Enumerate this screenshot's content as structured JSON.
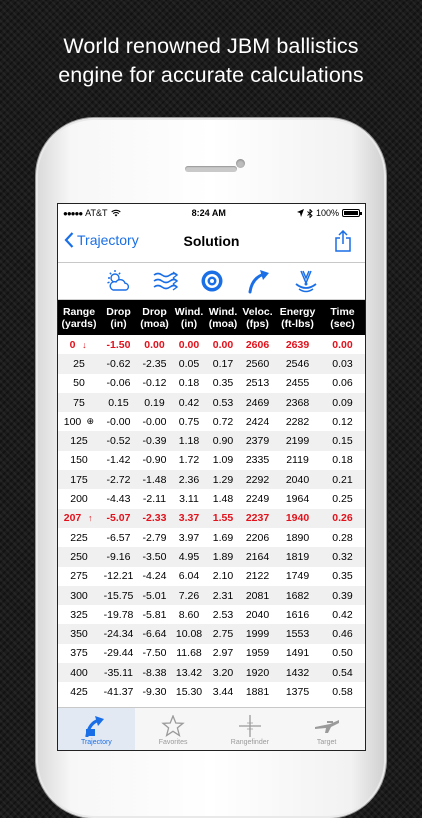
{
  "headline": {
    "line1": "World renowned JBM ballistics",
    "line2": "engine for accurate calculations"
  },
  "status": {
    "carrier": "AT&T",
    "time": "8:24 AM",
    "battery": "100%"
  },
  "nav": {
    "back_label": "Trajectory",
    "title": "Solution"
  },
  "toolbar_icons": [
    "weather-icon",
    "wind-icon",
    "target-icon",
    "trajectory-icon",
    "zero-icon"
  ],
  "table": {
    "headers": [
      [
        "Range",
        "(yards)"
      ],
      [
        "Drop",
        "(in)"
      ],
      [
        "Drop",
        "(moa)"
      ],
      [
        "Wind.",
        "(in)"
      ],
      [
        "Wind.",
        "(moa)"
      ],
      [
        "Veloc.",
        "(fps)"
      ],
      [
        "Energy",
        "(ft-lbs)"
      ],
      [
        "Time",
        "(sec)"
      ]
    ],
    "rows": [
      {
        "range": "0",
        "mark": "↓",
        "red": true,
        "cells": [
          "-1.50",
          "0.00",
          "0.00",
          "0.00",
          "2606",
          "2639",
          "0.00"
        ]
      },
      {
        "range": "25",
        "mark": "",
        "red": false,
        "cells": [
          "-0.62",
          "-2.35",
          "0.05",
          "0.17",
          "2560",
          "2546",
          "0.03"
        ]
      },
      {
        "range": "50",
        "mark": "",
        "red": false,
        "cells": [
          "-0.06",
          "-0.12",
          "0.18",
          "0.35",
          "2513",
          "2455",
          "0.06"
        ]
      },
      {
        "range": "75",
        "mark": "",
        "red": false,
        "cells": [
          "0.15",
          "0.19",
          "0.42",
          "0.53",
          "2469",
          "2368",
          "0.09"
        ]
      },
      {
        "range": "100",
        "mark": "⊕",
        "red": false,
        "cells": [
          "-0.00",
          "-0.00",
          "0.75",
          "0.72",
          "2424",
          "2282",
          "0.12"
        ]
      },
      {
        "range": "125",
        "mark": "",
        "red": false,
        "cells": [
          "-0.52",
          "-0.39",
          "1.18",
          "0.90",
          "2379",
          "2199",
          "0.15"
        ]
      },
      {
        "range": "150",
        "mark": "",
        "red": false,
        "cells": [
          "-1.42",
          "-0.90",
          "1.72",
          "1.09",
          "2335",
          "2119",
          "0.18"
        ]
      },
      {
        "range": "175",
        "mark": "",
        "red": false,
        "cells": [
          "-2.72",
          "-1.48",
          "2.36",
          "1.29",
          "2292",
          "2040",
          "0.21"
        ]
      },
      {
        "range": "200",
        "mark": "",
        "red": false,
        "cells": [
          "-4.43",
          "-2.11",
          "3.11",
          "1.48",
          "2249",
          "1964",
          "0.25"
        ]
      },
      {
        "range": "207",
        "mark": "↑",
        "red": true,
        "cells": [
          "-5.07",
          "-2.33",
          "3.37",
          "1.55",
          "2237",
          "1940",
          "0.26"
        ]
      },
      {
        "range": "225",
        "mark": "",
        "red": false,
        "cells": [
          "-6.57",
          "-2.79",
          "3.97",
          "1.69",
          "2206",
          "1890",
          "0.28"
        ]
      },
      {
        "range": "250",
        "mark": "",
        "red": false,
        "cells": [
          "-9.16",
          "-3.50",
          "4.95",
          "1.89",
          "2164",
          "1819",
          "0.32"
        ]
      },
      {
        "range": "275",
        "mark": "",
        "red": false,
        "cells": [
          "-12.21",
          "-4.24",
          "6.04",
          "2.10",
          "2122",
          "1749",
          "0.35"
        ]
      },
      {
        "range": "300",
        "mark": "",
        "red": false,
        "cells": [
          "-15.75",
          "-5.01",
          "7.26",
          "2.31",
          "2081",
          "1682",
          "0.39"
        ]
      },
      {
        "range": "325",
        "mark": "",
        "red": false,
        "cells": [
          "-19.78",
          "-5.81",
          "8.60",
          "2.53",
          "2040",
          "1616",
          "0.42"
        ]
      },
      {
        "range": "350",
        "mark": "",
        "red": false,
        "cells": [
          "-24.34",
          "-6.64",
          "10.08",
          "2.75",
          "1999",
          "1553",
          "0.46"
        ]
      },
      {
        "range": "375",
        "mark": "",
        "red": false,
        "cells": [
          "-29.44",
          "-7.50",
          "11.68",
          "2.97",
          "1959",
          "1491",
          "0.50"
        ]
      },
      {
        "range": "400",
        "mark": "",
        "red": false,
        "cells": [
          "-35.11",
          "-8.38",
          "13.42",
          "3.20",
          "1920",
          "1432",
          "0.54"
        ]
      },
      {
        "range": "425",
        "mark": "",
        "red": false,
        "cells": [
          "-41.37",
          "-9.30",
          "15.30",
          "3.44",
          "1881",
          "1375",
          "0.58"
        ]
      }
    ]
  },
  "tabs": [
    {
      "label": "Trajectory",
      "icon": "trajectory-tab-icon",
      "active": true
    },
    {
      "label": "Favorites",
      "icon": "star-icon",
      "active": false
    },
    {
      "label": "Rangefinder",
      "icon": "crosshair-icon",
      "active": false
    },
    {
      "label": "Target",
      "icon": "rifle-icon",
      "active": false
    }
  ],
  "colors": {
    "accent": "#1a6fe6",
    "highlight_row": "#e2111b",
    "header_bg": "#000000"
  }
}
